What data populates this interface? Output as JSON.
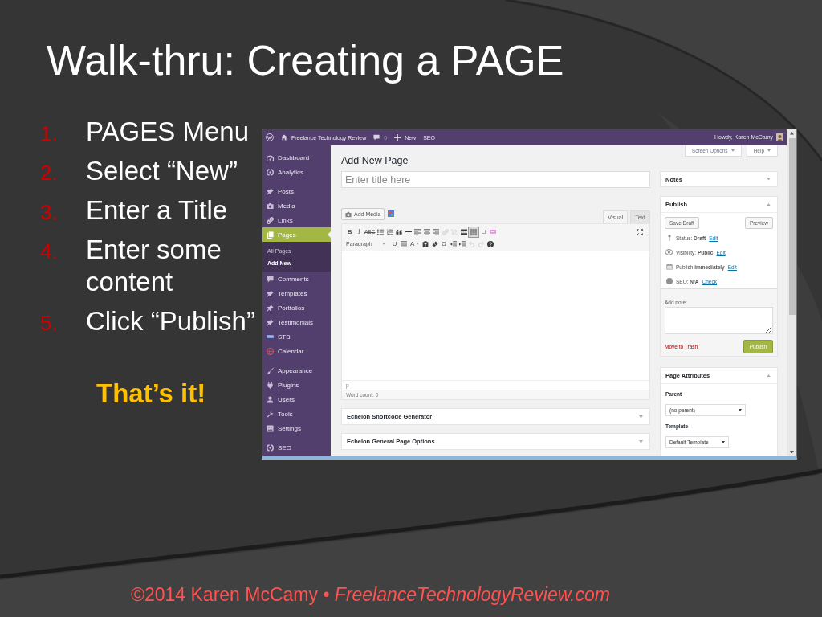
{
  "title": "Walk-thru: Creating a PAGE",
  "steps": [
    {
      "number": "1.",
      "text": "PAGES Menu"
    },
    {
      "number": "2.",
      "text": "Select “New”"
    },
    {
      "number": "3.",
      "text": "Enter a Title"
    },
    {
      "number": "4.",
      "text": "Enter some content"
    },
    {
      "number": "5.",
      "text": "Click “Publish”"
    }
  ],
  "callout": "That’s it!",
  "screenshot": {
    "admin_bar": {
      "site_name": "Freelance Technology Review",
      "comment_count": "0",
      "new_label": "New",
      "seo_label": "SEO",
      "greeting": "Howdy, Karen McCamy"
    },
    "sidebar": {
      "groups": [
        {
          "items": [
            {
              "label": "Dashboard",
              "selected": false
            },
            {
              "label": "Analytics",
              "selected": false
            }
          ]
        },
        {
          "items": [
            {
              "label": "Posts",
              "selected": false
            },
            {
              "label": "Media",
              "selected": false
            },
            {
              "label": "Links",
              "selected": false
            },
            {
              "label": "Pages",
              "selected": true,
              "submenu": [
                {
                  "label": "All Pages",
                  "selected": false
                },
                {
                  "label": "Add New",
                  "selected": true
                }
              ]
            },
            {
              "label": "Comments",
              "selected": false
            },
            {
              "label": "Templates",
              "selected": false
            },
            {
              "label": "Portfolios",
              "selected": false
            },
            {
              "label": "Testimonials",
              "selected": false
            },
            {
              "label": "STB",
              "selected": false
            },
            {
              "label": "Calendar",
              "selected": false
            }
          ]
        },
        {
          "items": [
            {
              "label": "Appearance",
              "selected": false
            },
            {
              "label": "Plugins",
              "selected": false
            },
            {
              "label": "Users",
              "selected": false
            },
            {
              "label": "Tools",
              "selected": false
            },
            {
              "label": "Settings",
              "selected": false
            }
          ]
        },
        {
          "items": [
            {
              "label": "SEO",
              "selected": false
            }
          ]
        }
      ]
    },
    "screen_tabs": [
      "Screen Options",
      "Help"
    ],
    "heading": "Add New Page",
    "title_field": {
      "placeholder": "Enter title here"
    },
    "add_media": "Add Media",
    "editor_tabs": [
      {
        "label": "Visual",
        "selected": true
      },
      {
        "label": "Text",
        "selected": false
      }
    ],
    "toolbar_rows": [
      [
        {
          "kind": "bold",
          "text": "B",
          "pressed": false,
          "disabled": false
        },
        {
          "kind": "italic",
          "text": "I",
          "pressed": false,
          "disabled": false
        },
        {
          "kind": "strike",
          "text": "ABC",
          "pressed": false,
          "disabled": false
        },
        {
          "kind": "icon",
          "pressed": false,
          "disabled": false
        },
        {
          "kind": "icon",
          "pressed": false,
          "disabled": false
        },
        {
          "kind": "icon",
          "pressed": false,
          "disabled": false
        },
        {
          "kind": "icon",
          "pressed": false,
          "disabled": false
        },
        {
          "kind": "icon",
          "pressed": false,
          "disabled": false
        },
        {
          "kind": "icon",
          "pressed": false,
          "disabled": false
        },
        {
          "kind": "icon",
          "pressed": false,
          "disabled": false
        },
        {
          "kind": "icon",
          "pressed": false,
          "disabled": true
        },
        {
          "kind": "icon",
          "pressed": false,
          "disabled": true
        },
        {
          "kind": "icon",
          "pressed": false,
          "disabled": false
        },
        {
          "kind": "icon",
          "pressed": true,
          "disabled": false
        },
        {
          "kind": "char",
          "text": "Li",
          "pressed": false,
          "disabled": false
        },
        {
          "kind": "icon",
          "pressed": false,
          "disabled": false
        }
      ],
      [
        {
          "kind": "dropdown",
          "text": "Paragraph",
          "pressed": false,
          "disabled": false
        },
        {
          "kind": "underline",
          "text": "U",
          "pressed": false,
          "disabled": false
        },
        {
          "kind": "icon",
          "pressed": false,
          "disabled": false
        },
        {
          "kind": "textcolor",
          "text": "A",
          "pressed": false,
          "disabled": false
        },
        {
          "kind": "icon",
          "pressed": false,
          "disabled": false
        },
        {
          "kind": "icon",
          "pressed": false,
          "disabled": false
        },
        {
          "kind": "char",
          "text": "Ω",
          "pressed": false,
          "disabled": false
        },
        {
          "kind": "icon",
          "pressed": false,
          "disabled": false
        },
        {
          "kind": "icon",
          "pressed": false,
          "disabled": false
        },
        {
          "kind": "icon",
          "pressed": false,
          "disabled": true
        },
        {
          "kind": "icon",
          "pressed": false,
          "disabled": true
        },
        {
          "kind": "icon",
          "pressed": false,
          "disabled": false
        }
      ]
    ],
    "path": "p",
    "word_count": "Word count: 0",
    "meta_boxes": [
      {
        "title": "Echelon Shortcode Generator",
        "expanded": false
      },
      {
        "title": "Echelon General Page Options",
        "expanded": false
      }
    ],
    "notes": {
      "title": "Notes",
      "expanded": false
    },
    "publish": {
      "title": "Publish",
      "expanded": true,
      "save_draft": "Save Draft",
      "preview": "Preview",
      "rows": [
        {
          "text": "Status: **Draft**",
          "link": "Edit"
        },
        {
          "text": "Visibility: **Public**",
          "link": "Edit"
        },
        {
          "text": "Publish **immediately**",
          "link": "Edit"
        },
        {
          "text": "SEO: **N/A**",
          "link": "Check"
        }
      ],
      "note_label": "Add note:",
      "trash": "Move to Trash",
      "button": "Publish"
    },
    "page_attributes": {
      "title": "Page Attributes",
      "expanded": true,
      "parent_label": "Parent",
      "parent": "(no parent)",
      "template_label": "Template",
      "template": "Default Template"
    }
  },
  "footer": "©2014 Karen McCamy • *FreelanceTechnologyReview.com*"
}
